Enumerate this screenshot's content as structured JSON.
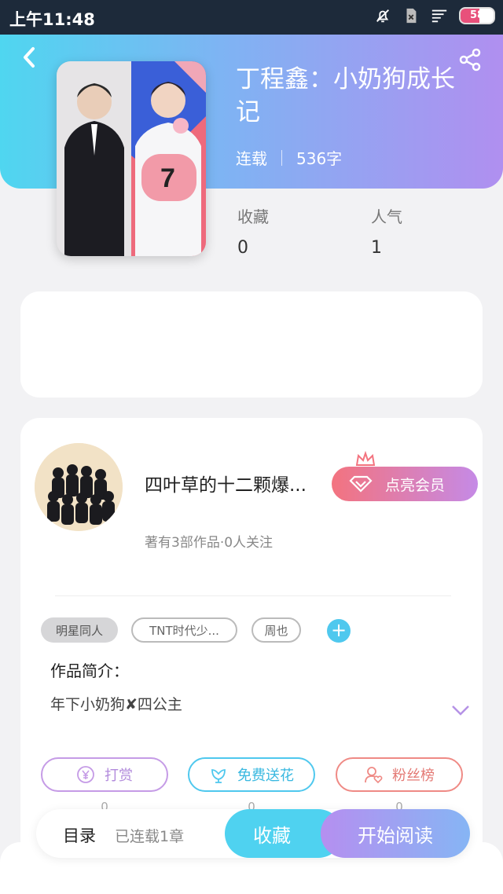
{
  "status_bar": {
    "time": "上午11:48",
    "battery": "58",
    "battery_level": 0.58
  },
  "header": {
    "back_icon": "back-arrow-icon",
    "share_icon": "share-icon"
  },
  "book": {
    "title": "丁程鑫：小奶狗成长记",
    "status": "连载",
    "word_count": "536字",
    "stats": [
      {
        "label": "收藏",
        "value": "0"
      },
      {
        "label": "人气",
        "value": "1"
      }
    ]
  },
  "author": {
    "name": "四叶草的十二颗爆...",
    "works": "著有3部作品·0人关注",
    "vip_label": "点亮会员"
  },
  "tags": [
    "明星同人",
    "TNT时代少...",
    "周也"
  ],
  "intro": {
    "label": "作品简介：",
    "text": "年下小奶狗✘四公主"
  },
  "actions": [
    {
      "label": "打赏",
      "count": "0",
      "color": "#c59be6",
      "icon": "yen-coin-icon"
    },
    {
      "label": "免费送花",
      "count": "0",
      "color": "#4fc8ee",
      "icon": "flower-icon"
    },
    {
      "label": "粉丝榜",
      "count": "0",
      "color": "#ef8a85",
      "icon": "fan-user-icon"
    }
  ],
  "bottom": {
    "toc_label": "目录",
    "serial_label": "已连载1章",
    "fav_label": "收藏",
    "read_label": "开始阅读"
  },
  "colors": {
    "accent_cyan": "#4fd6f0",
    "accent_purple": "#b08ff0",
    "vip_start": "#f3737f"
  }
}
